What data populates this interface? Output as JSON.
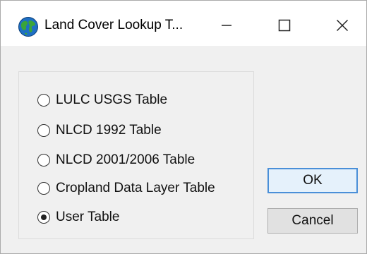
{
  "window": {
    "title": "Land Cover Lookup T...",
    "icon": "globe-icon"
  },
  "caption_buttons": {
    "minimize": "minimize-icon",
    "maximize": "maximize-icon",
    "close": "close-icon"
  },
  "options": [
    {
      "label": "LULC USGS Table",
      "selected": false
    },
    {
      "label": "NLCD 1992 Table",
      "selected": false
    },
    {
      "label": "NLCD 2001/2006 Table",
      "selected": false
    },
    {
      "label": "Cropland Data Layer Table",
      "selected": false
    },
    {
      "label": "User Table",
      "selected": true
    }
  ],
  "buttons": {
    "ok_label": "OK",
    "cancel_label": "Cancel"
  },
  "colors": {
    "title_bar": "#ffffff",
    "dialog_background": "#f0f0f0",
    "default_button_border": "#4a8fd8"
  }
}
